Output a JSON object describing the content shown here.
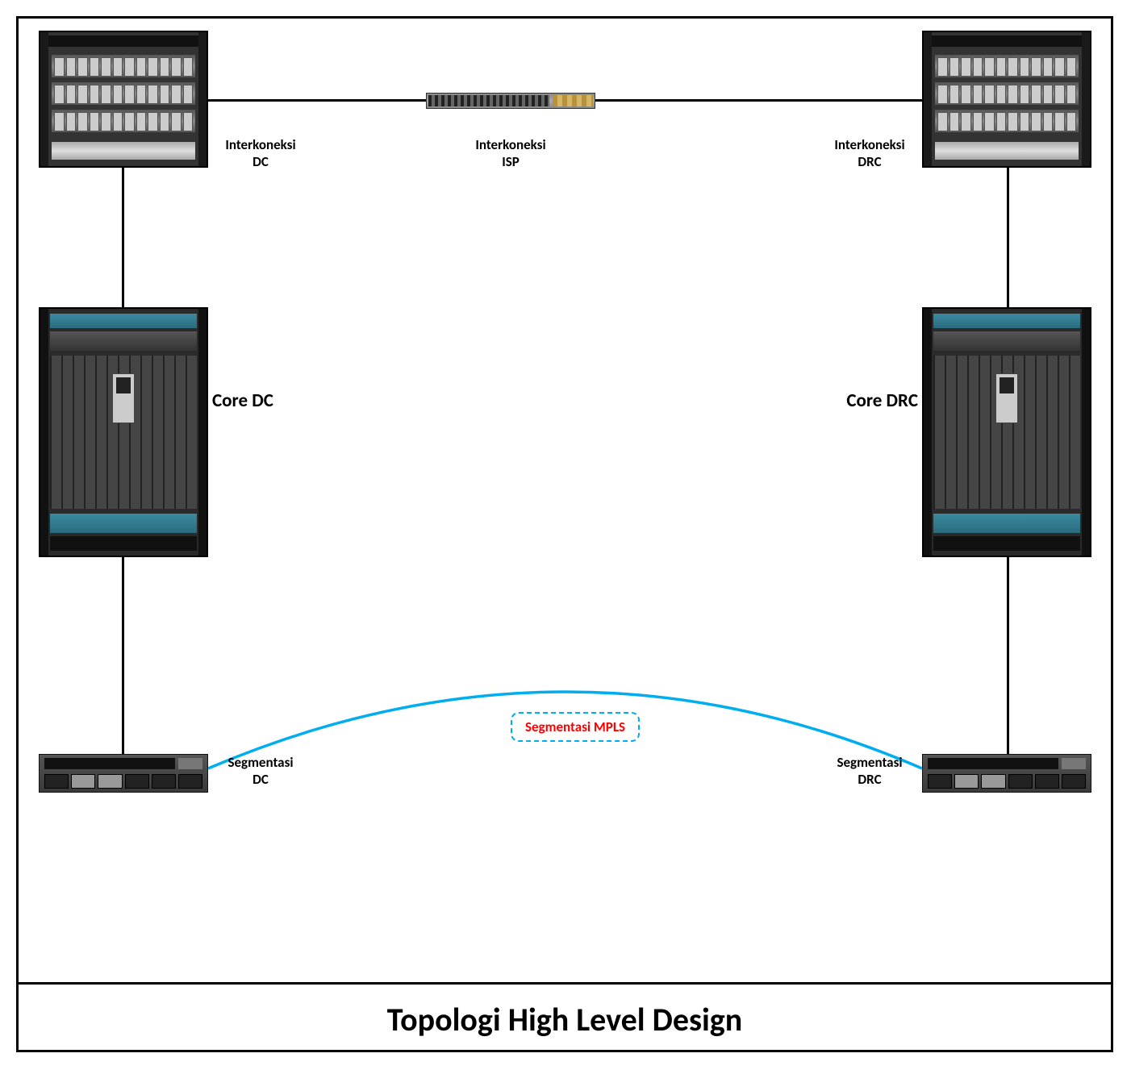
{
  "title": "Topologi High Level Design",
  "nodes": {
    "interkoneksi_dc": {
      "label": "Interkoneksi\nDC"
    },
    "interkoneksi_isp": {
      "label": "Interkoneksi\nISP"
    },
    "interkoneksi_drc": {
      "label": "Interkoneksi\nDRC"
    },
    "core_dc": {
      "label": "Core DC"
    },
    "core_drc": {
      "label": "Core DRC"
    },
    "segmentasi_dc": {
      "label": "Segmentasi\nDC"
    },
    "segmentasi_drc": {
      "label": "Segmentasi\nDRC"
    },
    "segmentasi_mpls": {
      "label": "Segmentasi\nMPLS"
    }
  },
  "links": [
    {
      "from": "interkoneksi_dc",
      "to": "interkoneksi_isp",
      "style": "solid",
      "color": "#000000"
    },
    {
      "from": "interkoneksi_isp",
      "to": "interkoneksi_drc",
      "style": "solid",
      "color": "#000000"
    },
    {
      "from": "interkoneksi_dc",
      "to": "core_dc",
      "style": "solid",
      "color": "#000000"
    },
    {
      "from": "interkoneksi_drc",
      "to": "core_drc",
      "style": "solid",
      "color": "#000000"
    },
    {
      "from": "core_dc",
      "to": "segmentasi_dc",
      "style": "solid",
      "color": "#000000"
    },
    {
      "from": "core_drc",
      "to": "segmentasi_drc",
      "style": "solid",
      "color": "#000000"
    },
    {
      "from": "segmentasi_dc",
      "to": "segmentasi_drc",
      "style": "arc",
      "color": "#00aeef",
      "via": "segmentasi_mpls"
    }
  ],
  "colors": {
    "link_default": "#000000",
    "link_mpls": "#00aeef",
    "mpls_text": "#ff0000"
  }
}
